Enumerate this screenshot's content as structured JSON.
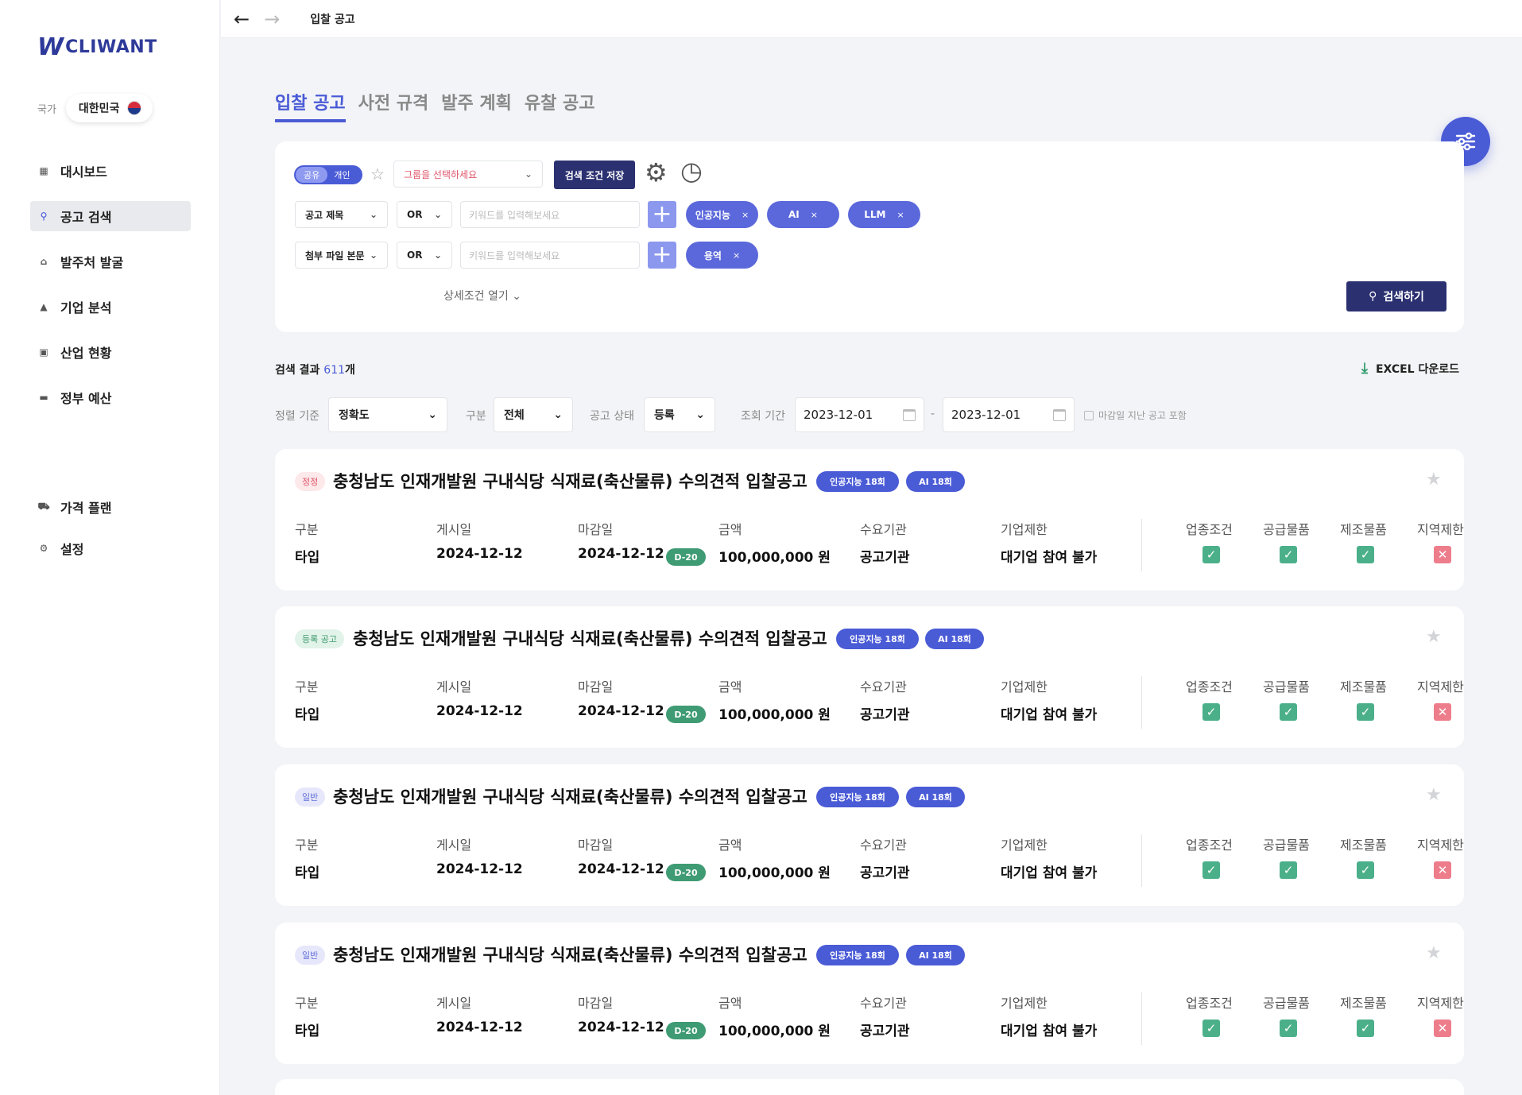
{
  "brand": {
    "mark": "W",
    "name": "CLIWANT"
  },
  "country": {
    "label": "국가",
    "value": "대한민국"
  },
  "sidebar": {
    "items": [
      {
        "label": "대시보드",
        "icon": "dashboard-icon"
      },
      {
        "label": "공고 검색",
        "icon": "search-icon",
        "active": true
      },
      {
        "label": "발주처 발굴",
        "icon": "building-icon"
      },
      {
        "label": "기업 분석",
        "icon": "chart-icon"
      },
      {
        "label": "산업 현황",
        "icon": "industry-icon"
      },
      {
        "label": "정부 예산",
        "icon": "budget-icon"
      },
      {
        "label": "가격 플랜",
        "icon": "cart-icon"
      },
      {
        "label": "설정",
        "icon": "gear-icon"
      }
    ]
  },
  "topbar": {
    "breadcrumb": "입찰 공고"
  },
  "tabs": [
    {
      "label": "입찰 공고",
      "active": true
    },
    {
      "label": "사전 규격"
    },
    {
      "label": "발주 계획"
    },
    {
      "label": "유찰 공고"
    }
  ],
  "search_panel": {
    "toggle_on": "공유",
    "toggle_off": "개인",
    "group_placeholder": "그룹을 선택하세요",
    "save_button": "검색 조건 저장",
    "row1": {
      "field": "공고 제목",
      "operator": "OR",
      "placeholder": "키워드를 입력해보세요",
      "chips": [
        "인공지능",
        "AI",
        "LLM"
      ]
    },
    "row2": {
      "field": "첨부 파일 본문",
      "operator": "OR",
      "placeholder": "키워드를 입력해보세요",
      "chips": [
        "용역"
      ]
    },
    "detail_toggle": "상세조건 열기",
    "search_button": "검색하기"
  },
  "results": {
    "prefix": "검색 결과",
    "count": "611",
    "suffix": "개",
    "excel_label": "EXCEL 다운로드"
  },
  "sort": {
    "sort_label": "정렬 기준",
    "sort_value": "정확도",
    "type_label": "구분",
    "type_value": "전체",
    "status_label": "공고 상태",
    "status_value": "등록",
    "period_label": "조회 기간",
    "date_from": "2023-12-01",
    "date_sep": "-",
    "date_to": "2023-12-01",
    "include_expired": "마감일 지난 공고 포함"
  },
  "columns": {
    "type": "구분",
    "posted": "게시일",
    "deadline": "마감일",
    "amount": "금액",
    "agency": "수요기관",
    "restriction": "기업제한",
    "industry": "업종조건",
    "supply": "공급물품",
    "manufacture": "제조물품",
    "region": "지역제한"
  },
  "cards": [
    {
      "status": "정정",
      "status_color": "#e0566a",
      "title": "충청남도 인재개발원 구내식당 식재료(축산물류) 수의견적 입찰공고",
      "tags": [
        "인공지능 18회",
        "AI 18회"
      ],
      "type": "타입",
      "posted": "2024-12-12",
      "deadline": "2024-12-12",
      "dday": "D-20",
      "amount": "100,000,000 원",
      "agency": "공고기관",
      "restriction": "대기업 참여 불가"
    },
    {
      "status": "등록 공고",
      "status_color": "#3a9a6a",
      "title": "충청남도 인재개발원 구내식당 식재료(축산물류) 수의견적 입찰공고",
      "tags": [
        "인공지능 18회",
        "AI 18회"
      ],
      "type": "타입",
      "posted": "2024-12-12",
      "deadline": "2024-12-12",
      "dday": "D-20",
      "amount": "100,000,000 원",
      "agency": "공고기관",
      "restriction": "대기업 참여 불가"
    },
    {
      "status": "일반",
      "status_color": "#6270d8",
      "title": "충청남도 인재개발원 구내식당 식재료(축산물류) 수의견적 입찰공고",
      "tags": [
        "인공지능 18회",
        "AI 18회"
      ],
      "type": "타입",
      "posted": "2024-12-12",
      "deadline": "2024-12-12",
      "dday": "D-20",
      "amount": "100,000,000 원",
      "agency": "공고기관",
      "restriction": "대기업 참여 불가"
    },
    {
      "status": "일반",
      "status_color": "#6270d8",
      "title": "충청남도 인재개발원 구내식당 식재료(축산물류) 수의견적 입찰공고",
      "tags": [
        "인공지능 18회",
        "AI 18회"
      ],
      "type": "타입",
      "posted": "2024-12-12",
      "deadline": "2024-12-12",
      "dday": "D-20",
      "amount": "100,000,000 원",
      "agency": "공고기관",
      "restriction": "대기업 참여 불가"
    }
  ],
  "colors": {
    "accent": "#4a5bd6",
    "dark_button": "#2b3070",
    "ok": "#4bb08a",
    "no": "#ee7d8b",
    "dday": "#3f9b73"
  }
}
